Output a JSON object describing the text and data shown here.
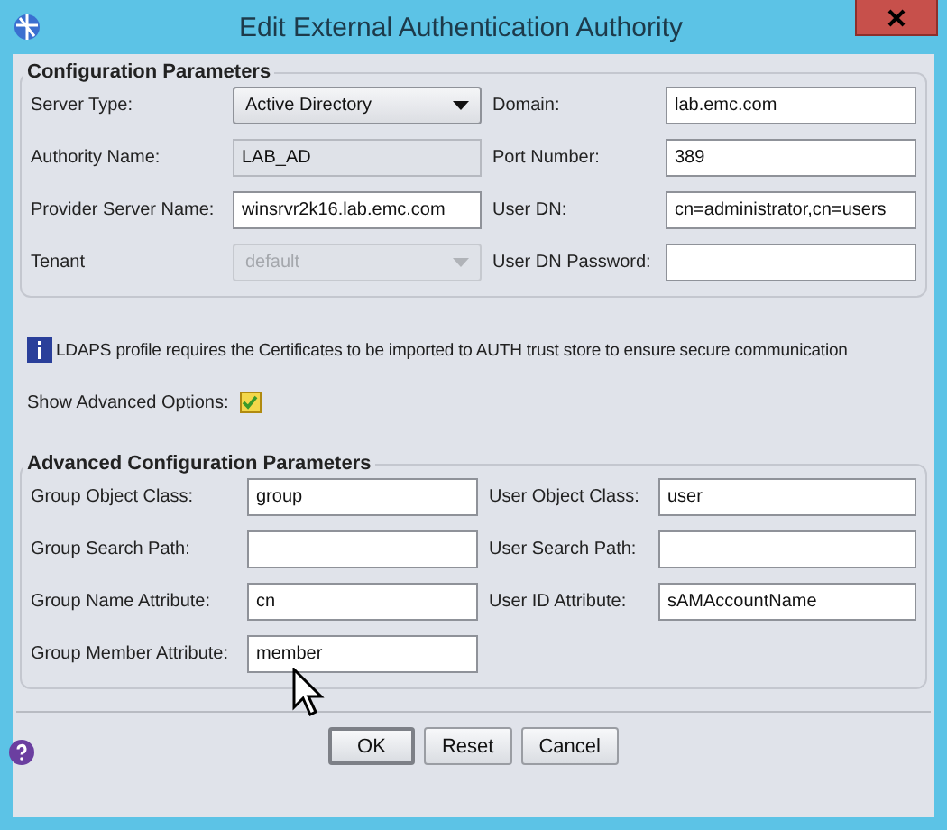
{
  "window": {
    "title": "Edit External Authentication Authority"
  },
  "configuration": {
    "title": "Configuration Parameters",
    "fields": [
      {
        "label": "Server Type:",
        "value": "Active Directory",
        "kind": "select",
        "disabled": false
      },
      {
        "label": "Domain:",
        "value": "lab.emc.com",
        "kind": "text",
        "disabled": false
      },
      {
        "label": "Authority Name:",
        "value": "LAB_AD",
        "kind": "text",
        "disabled": true
      },
      {
        "label": "Port Number:",
        "value": "389",
        "kind": "text",
        "disabled": false
      },
      {
        "label": "Provider Server Name:",
        "value": "winsrvr2k16.lab.emc.com",
        "kind": "text",
        "disabled": false
      },
      {
        "label": "User DN:",
        "value": "cn=administrator,cn=users",
        "kind": "text",
        "disabled": false
      },
      {
        "label": "Tenant",
        "value": "default",
        "kind": "select",
        "disabled": true
      },
      {
        "label": "User DN Password:",
        "kind": "password",
        "disabled": false
      }
    ]
  },
  "info": "LDAPS profile requires the Certificates to be imported to AUTH trust store  to ensure secure communication",
  "advanced_toggle": {
    "label": "Show Advanced Options:",
    "checked": true
  },
  "advanced": {
    "title": "Advanced Configuration Parameters",
    "fields": [
      {
        "label": "Group Object Class:",
        "value": "group",
        "kind": "text",
        "disabled": false
      },
      {
        "label": "User Object Class:",
        "value": "user",
        "kind": "text",
        "disabled": false
      },
      {
        "label": "Group Search Path:",
        "kind": "text",
        "disabled": false
      },
      {
        "label": "User Search Path:",
        "kind": "text",
        "disabled": false
      },
      {
        "label": "Group Name Attribute:",
        "value": "cn",
        "kind": "text",
        "disabled": false
      },
      {
        "label": "User ID Attribute:",
        "value": "sAMAccountName",
        "kind": "text",
        "disabled": false
      },
      {
        "label": "Group Member Attribute:",
        "value": "member",
        "kind": "text",
        "disabled": false
      }
    ]
  },
  "buttons": [
    {
      "label": "OK",
      "default": true
    },
    {
      "label": "Reset",
      "default": false
    },
    {
      "label": "Cancel",
      "default": false
    }
  ]
}
